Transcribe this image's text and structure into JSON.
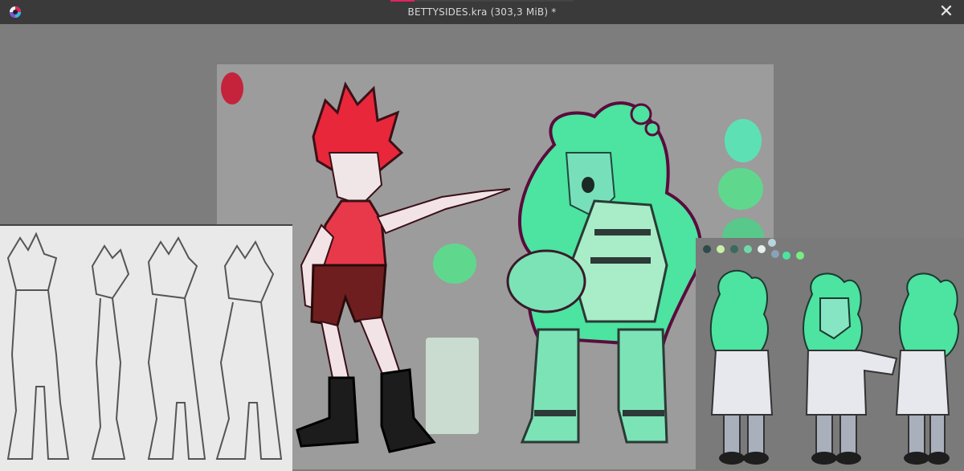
{
  "window": {
    "title": "BETTYSIDES.kra (303,3 MiB) *",
    "close_symbol": "✕",
    "icon": "krita-app-icon",
    "progress": 0.13
  },
  "colors": {
    "titlebar": "#3a3a3a",
    "workspace": "#7d7d7d",
    "canvas": "#9c9c9c",
    "red_hair": "#e8273a",
    "slime_green": "#4de3a0",
    "progress_accent": "#e0245e"
  }
}
